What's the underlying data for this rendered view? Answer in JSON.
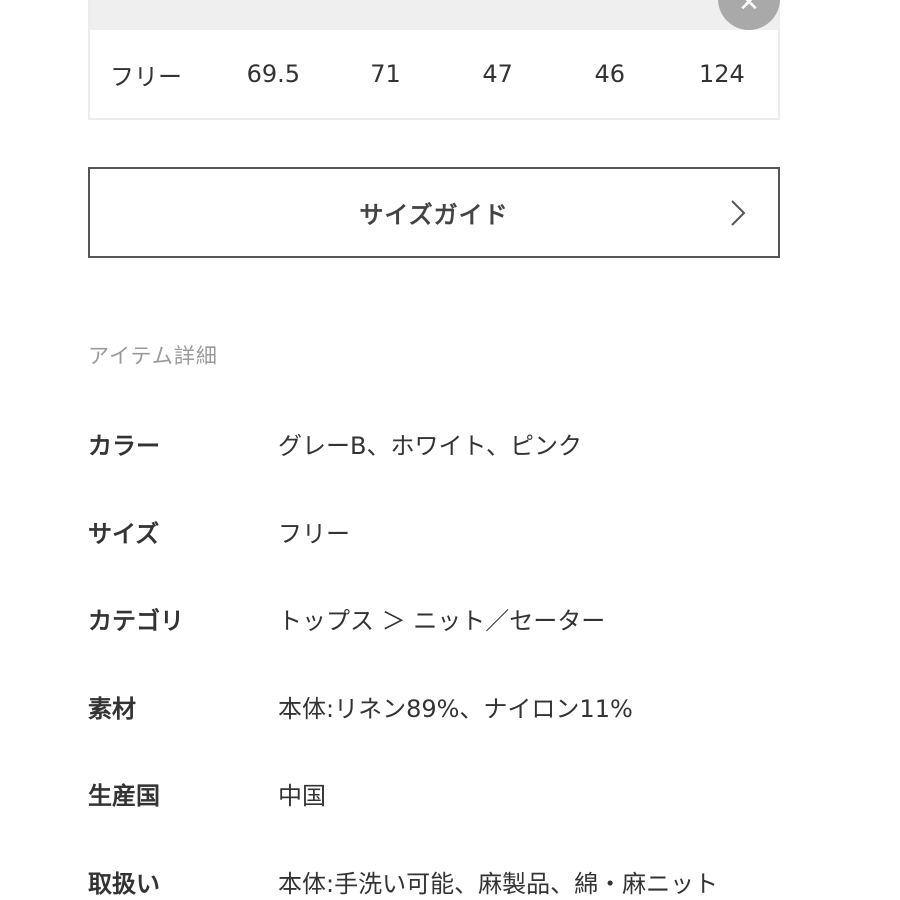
{
  "size_table": {
    "row": {
      "size": "フリー",
      "values": [
        "69.5",
        "71",
        "47",
        "46",
        "124"
      ]
    }
  },
  "close_icon": "close-icon",
  "size_guide": {
    "label": "サイズガイド",
    "icon": "chevron-right-icon"
  },
  "details": {
    "heading": "アイテム詳細",
    "rows": [
      {
        "label": "カラー",
        "value": "グレーB、ホワイト、ピンク"
      },
      {
        "label": "サイズ",
        "value": "フリー"
      },
      {
        "label": "カテゴリ",
        "value": "トップス ＞ ニット／セーター"
      },
      {
        "label": "素材",
        "value": "本体:リネン89%、ナイロン11%"
      },
      {
        "label": "生産国",
        "value": "中国"
      },
      {
        "label": "取扱い",
        "value": "本体:手洗い可能、麻製品、綿・麻ニット"
      }
    ]
  }
}
